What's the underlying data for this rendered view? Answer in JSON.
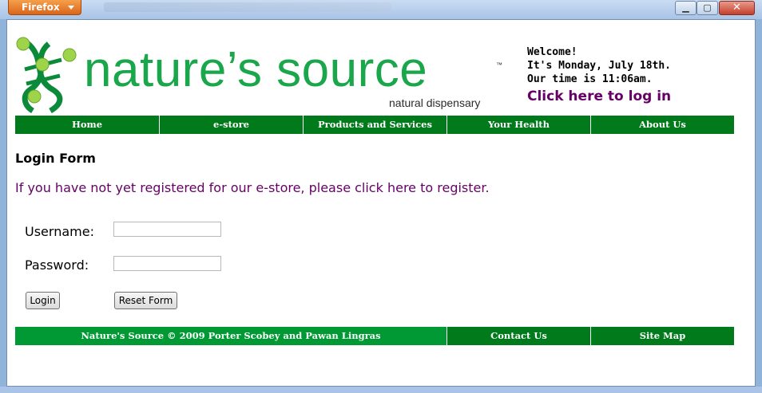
{
  "browser": {
    "menu_button_label": "Firefox",
    "window_controls": {
      "minimize_icon": "minimize-icon",
      "maximize_icon": "maximize-icon",
      "close_icon": "close-icon"
    }
  },
  "header": {
    "logo_text": "nature’s source",
    "logo_tagline": "natural dispensary",
    "logo_trademark": "™",
    "welcome_line": "Welcome!",
    "date_line": "It's Monday, July 18th.",
    "time_line": "Our time is 11:06am.",
    "login_link": "Click here to log in"
  },
  "nav": {
    "items": [
      {
        "label": "Home"
      },
      {
        "label": "e-store"
      },
      {
        "label": "Products and Services"
      },
      {
        "label": "Your Health"
      },
      {
        "label": "About Us"
      }
    ]
  },
  "main": {
    "heading": "Login Form",
    "register_text": "If you have not yet registered for our e-store, please click here to register.",
    "username_label": "Username:",
    "username_value": "",
    "password_label": "Password:",
    "password_value": "",
    "login_button": "Login",
    "reset_button": "Reset Form"
  },
  "footer": {
    "copyright": "Nature's Source © 2009 Porter Scobey and Pawan Lingras",
    "contact": "Contact Us",
    "sitemap": "Site Map"
  },
  "colors": {
    "brand_green": "#1aa64a",
    "nav_green": "#007a1a",
    "footer_green": "#009933",
    "link_purple": "#660066"
  }
}
